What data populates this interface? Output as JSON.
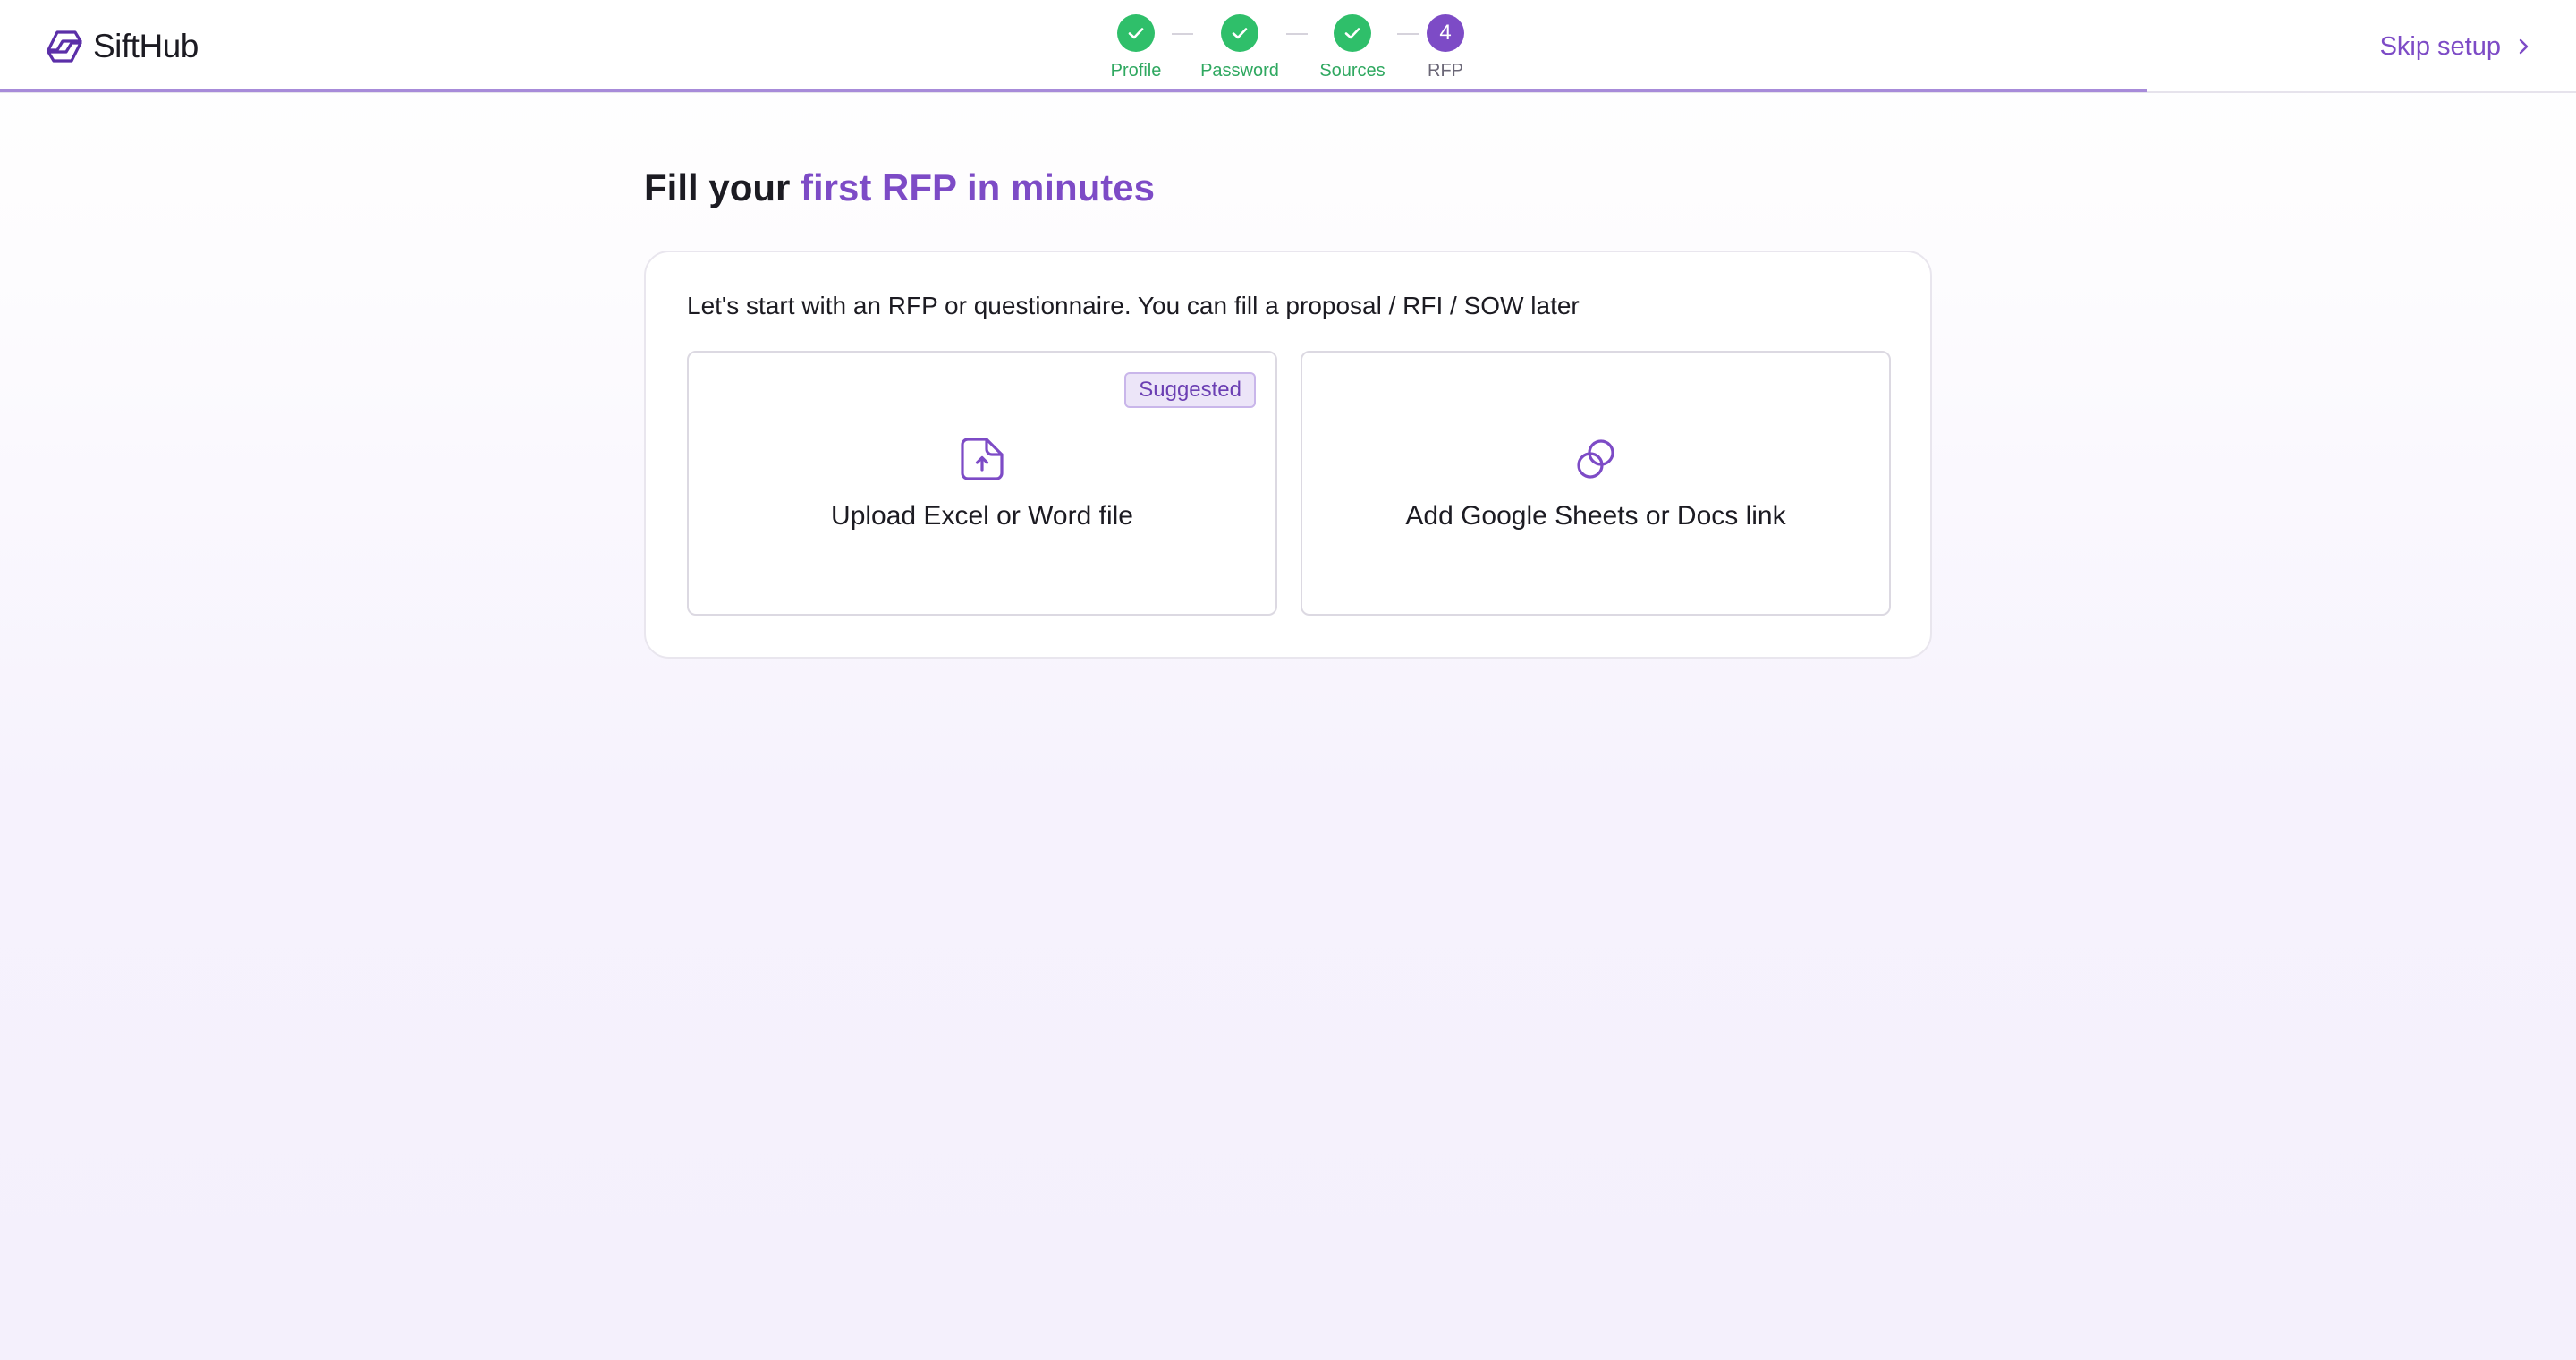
{
  "brand": {
    "name": "SiftHub",
    "accent": "#7d4bc6"
  },
  "stepper": {
    "steps": [
      {
        "label": "Profile",
        "status": "done",
        "icon": "check-icon"
      },
      {
        "label": "Password",
        "status": "done",
        "icon": "check-icon"
      },
      {
        "label": "Sources",
        "status": "done",
        "icon": "check-icon"
      },
      {
        "label": "RFP",
        "status": "current",
        "number": "4"
      }
    ],
    "colors": {
      "done": "#2fbf6a",
      "current": "#7d4bc6"
    }
  },
  "header": {
    "skip_label": "Skip setup"
  },
  "main": {
    "title_prefix": "Fill your",
    "title_accent": "first RFP in minutes",
    "intro": "Let's start with an RFP or questionnaire. You can fill a proposal / RFI / SOW later",
    "options": [
      {
        "label": "Upload Excel or Word file",
        "badge": "Suggested",
        "icon": "file-upload-icon"
      },
      {
        "label": "Add Google Sheets or Docs link",
        "icon": "link-icon"
      }
    ]
  }
}
